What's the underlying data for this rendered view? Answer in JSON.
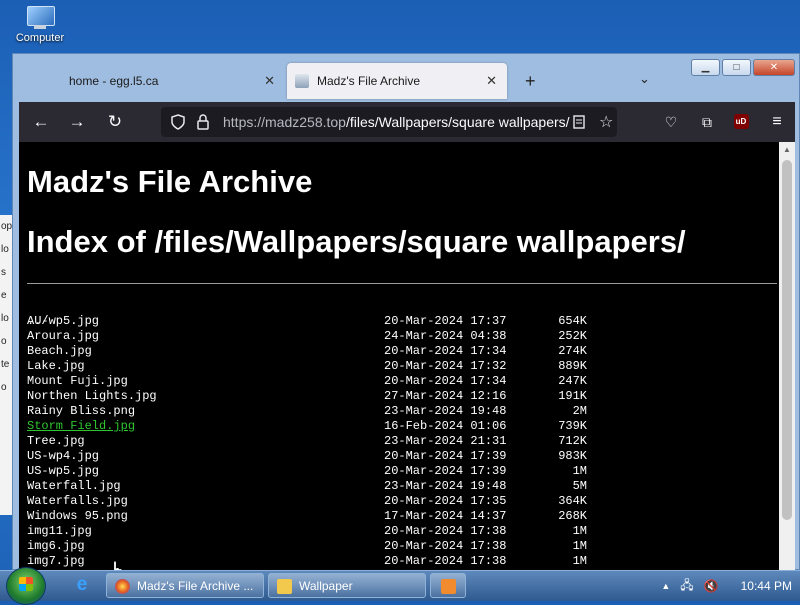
{
  "desktop": {
    "computer_label": "Computer",
    "left_strip_fragments": [
      "",
      "op",
      "lo",
      "s",
      "e",
      "lo",
      "",
      "o",
      "te",
      "o"
    ]
  },
  "window": {
    "tabs": [
      {
        "title": "home - egg.l5.ca",
        "close": "✕"
      },
      {
        "title": "Madz's File Archive",
        "close": "✕"
      }
    ],
    "new_tab": "+",
    "tab_list": "⌄",
    "controls": {
      "minimize": "▁",
      "maximize": "□",
      "close": "✕"
    }
  },
  "navbar": {
    "back": "←",
    "forward": "→",
    "reload": "↻",
    "url_host": "https://madz258.top",
    "url_path": "/files/Wallpapers/square wallpapers/",
    "icons": [
      "shield-icon",
      "lock-icon",
      "reader-icon",
      "star-icon",
      "pocket-icon",
      "extensions-icon",
      "ublock-icon",
      "menu-icon"
    ],
    "ublock_text": "uD"
  },
  "page": {
    "site_title": "Madz's File Archive",
    "index_title": "Index of /files/Wallpapers/square wallpapers/",
    "parent_link": "../",
    "files": [
      {
        "name": "AU-wp5.jpg",
        "date": "20-Mar-2024 17:37",
        "size": "654K"
      },
      {
        "name": "Aroura.jpg",
        "date": "24-Mar-2024 04:38",
        "size": "252K"
      },
      {
        "name": "Beach.jpg",
        "date": "20-Mar-2024 17:34",
        "size": "274K"
      },
      {
        "name": "Lake.jpg",
        "date": "20-Mar-2024 17:32",
        "size": "889K"
      },
      {
        "name": "Mount Fuji.jpg",
        "date": "20-Mar-2024 17:34",
        "size": "247K"
      },
      {
        "name": "Northen Lights.jpg",
        "date": "27-Mar-2024 12:16",
        "size": "191K"
      },
      {
        "name": "Rainy Bliss.png",
        "date": "23-Mar-2024 19:48",
        "size": "2M"
      },
      {
        "name": "Storm Field.jpg",
        "date": "16-Feb-2024 01:06",
        "size": "739K"
      },
      {
        "name": "Tree.jpg",
        "date": "23-Mar-2024 21:31",
        "size": "712K"
      },
      {
        "name": "US-wp4.jpg",
        "date": "20-Mar-2024 17:39",
        "size": "983K"
      },
      {
        "name": "US-wp5.jpg",
        "date": "20-Mar-2024 17:39",
        "size": "1M"
      },
      {
        "name": "Waterfall.jpg",
        "date": "23-Mar-2024 19:48",
        "size": "5M"
      },
      {
        "name": "Waterfalls.jpg",
        "date": "20-Mar-2024 17:35",
        "size": "364K"
      },
      {
        "name": "Windows 95.png",
        "date": "17-Mar-2024 14:37",
        "size": "268K"
      },
      {
        "name": "img11.jpg",
        "date": "20-Mar-2024 17:38",
        "size": "1M"
      },
      {
        "name": "img6.jpg",
        "date": "20-Mar-2024 17:38",
        "size": "1M"
      },
      {
        "name": "img7.jpg",
        "date": "20-Mar-2024 17:38",
        "size": "1M"
      }
    ],
    "hovered_file": "Storm Field.jpg",
    "link_hover_color": "#2ec52e"
  },
  "taskbar": {
    "buttons": [
      {
        "label": "Madz's File Archive ..."
      },
      {
        "label": "Wallpaper"
      },
      {
        "label": ""
      }
    ],
    "tray_arrow": "▲",
    "clock": "10:44 PM"
  }
}
